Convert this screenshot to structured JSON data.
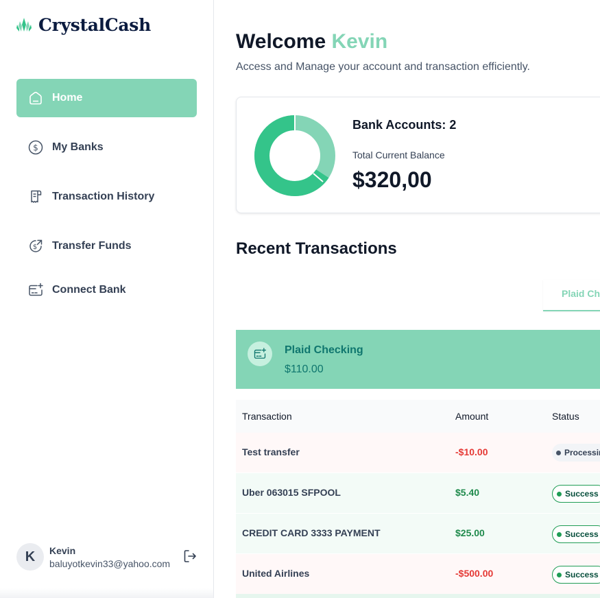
{
  "brand": {
    "name": "CrystalCash",
    "accent": "#84d5b6"
  },
  "sidebar": {
    "items": [
      {
        "label": "Home",
        "icon": "home-icon",
        "active": true
      },
      {
        "label": "My Banks",
        "icon": "dollar-circle-icon",
        "active": false
      },
      {
        "label": "Transaction History",
        "icon": "receipt-icon",
        "active": false
      },
      {
        "label": "Transfer Funds",
        "icon": "money-send-icon",
        "active": false
      },
      {
        "label": "Connect Bank",
        "icon": "card-add-icon",
        "active": false
      }
    ]
  },
  "user": {
    "initial": "K",
    "name": "Kevin",
    "email": "baluyotkevin33@yahoo.com",
    "logout_icon": "logout-icon"
  },
  "header": {
    "welcome": "Welcome",
    "name": "Kevin",
    "subtitle": "Access and Manage your account and transaction efficiently."
  },
  "balance": {
    "bank_accounts": "Bank Accounts: 2",
    "total_label": "Total Current Balance",
    "total_value": "$320,00",
    "donut_colors": [
      "#84d5b6",
      "#34c48a"
    ]
  },
  "recent": {
    "title": "Recent Transactions",
    "tab_label": "Plaid Ch"
  },
  "account_banner": {
    "name": "Plaid Checking",
    "balance": "$110.00",
    "icon": "card-add-icon"
  },
  "table": {
    "headers": {
      "transaction": "Transaction",
      "amount": "Amount",
      "status": "Status"
    },
    "rows": [
      {
        "name": "Test transfer",
        "amount": "-$10.00",
        "type": "debit",
        "status": "Processin"
      },
      {
        "name": "Uber 063015 SFPOOL",
        "amount": "$5.40",
        "type": "credit",
        "status": "Success"
      },
      {
        "name": "CREDIT CARD 3333 PAYMENT",
        "amount": "$25.00",
        "type": "credit",
        "status": "Success"
      },
      {
        "name": "United Airlines",
        "amount": "-$500.00",
        "type": "debit",
        "status": "Success"
      }
    ]
  }
}
